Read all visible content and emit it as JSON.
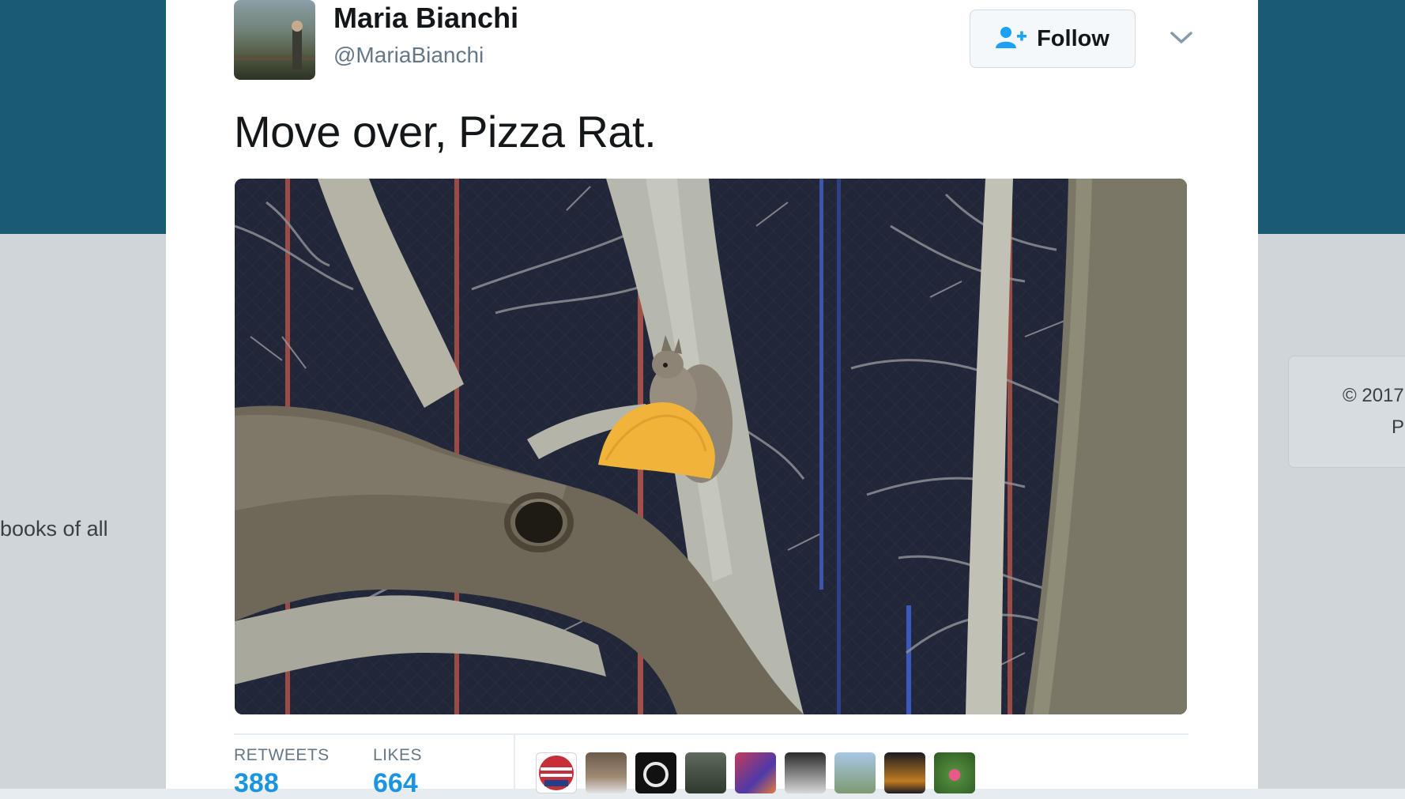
{
  "background": {
    "left_snippet": "books of all",
    "right_card_line1": "© 2017",
    "right_card_line2": "Pr"
  },
  "tweet": {
    "author_name": "Maria Bianchi",
    "author_handle": "@MariaBianchi",
    "follow_label": "Follow",
    "text": "Move over, Pizza Rat.",
    "image_alt": "Squirrel holding a taco shell in a tree",
    "stats": {
      "retweets_label": "RETWEETS",
      "retweets_value": "388",
      "likes_label": "LIKES",
      "likes_value": "664"
    },
    "liker_count_visible": 9
  },
  "colors": {
    "header_blue": "#1b5a75",
    "link_blue": "#1b95e0",
    "follow_icon_blue": "#1da1f2"
  },
  "icons": [
    "follow-person-plus-icon",
    "chevron-down-icon"
  ]
}
